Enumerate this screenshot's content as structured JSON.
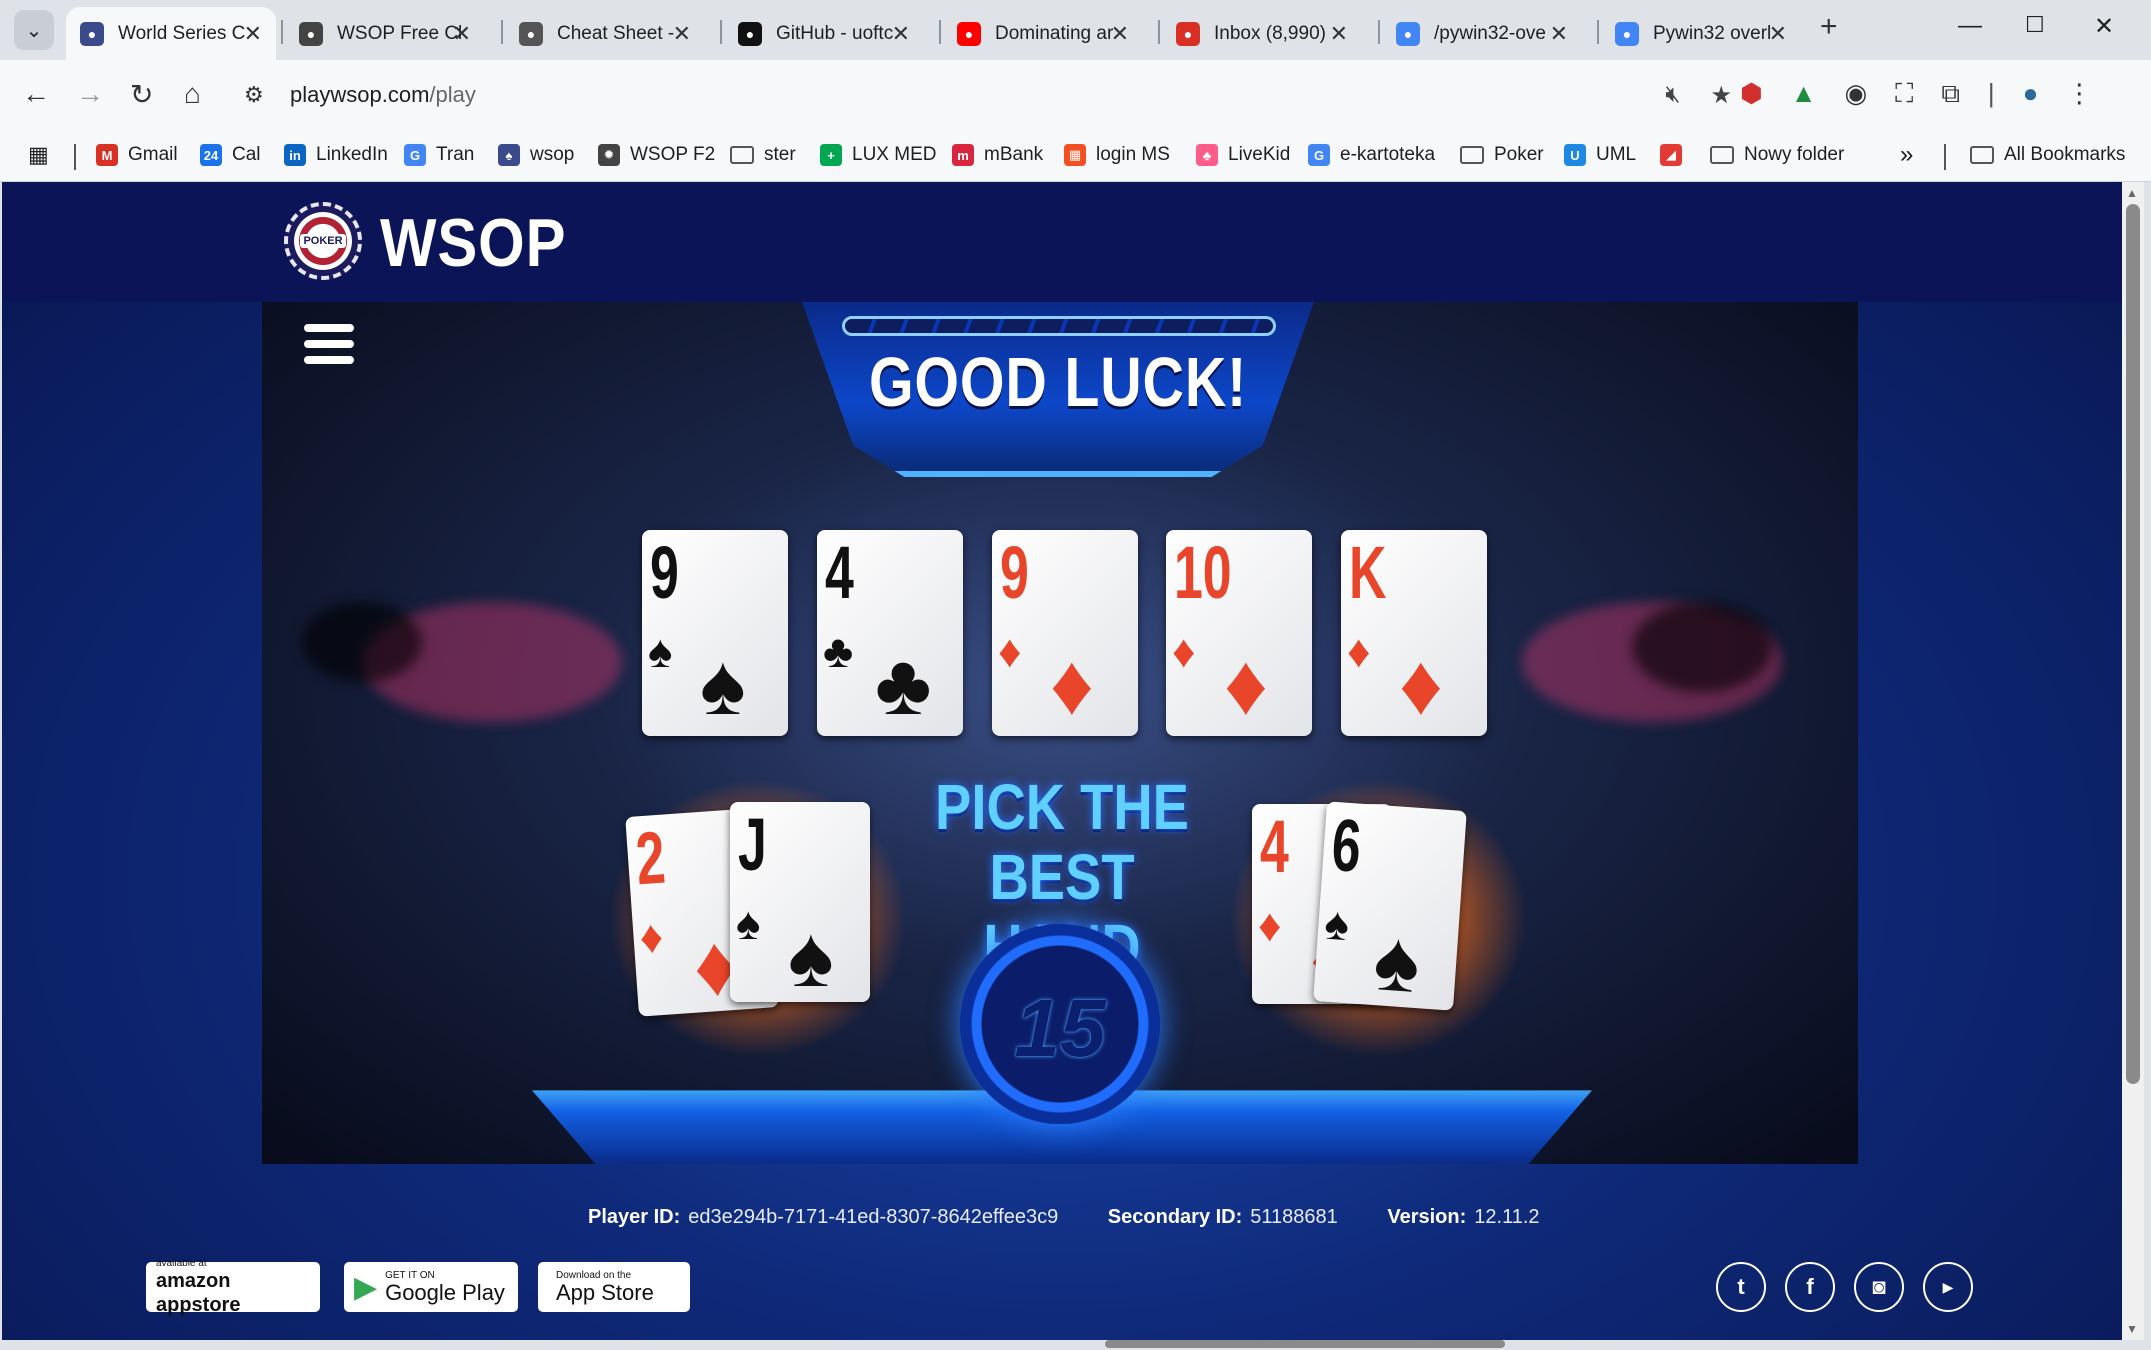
{
  "tabs": [
    {
      "title": "World Series C",
      "icon": "wsop-icon",
      "color": "#3b4a8a",
      "active": true
    },
    {
      "title": "WSOP Free Cl",
      "icon": "gear-icon",
      "color": "#444444"
    },
    {
      "title": "Cheat Sheet -",
      "icon": "sheet-icon",
      "color": "#555555"
    },
    {
      "title": "GitHub - uoftc",
      "icon": "github-icon",
      "color": "#111111"
    },
    {
      "title": "Dominating ar",
      "icon": "youtube-icon",
      "color": "#ff0000"
    },
    {
      "title": "Inbox (8,990)",
      "icon": "gmail-icon",
      "color": "#d93025"
    },
    {
      "title": "/pywin32-ove",
      "icon": "google-icon",
      "color": "#4285f4"
    },
    {
      "title": "Pywin32 overl",
      "icon": "google-icon",
      "color": "#4285f4"
    }
  ],
  "address": {
    "domain": "playwsop.com",
    "path": "/play"
  },
  "bookmarks": [
    {
      "label": "Gmail",
      "color": "#d93025",
      "glyph": "M"
    },
    {
      "label": "Cal",
      "color": "#1a73e8",
      "glyph": "24"
    },
    {
      "label": "LinkedIn",
      "color": "#0a66c2",
      "glyph": "in"
    },
    {
      "label": "Tran",
      "color": "#4285f4",
      "glyph": "G"
    },
    {
      "label": "wsop",
      "color": "#3b4a8a",
      "glyph": "♠"
    },
    {
      "label": "WSOP F2",
      "color": "#444444",
      "glyph": "✹"
    },
    {
      "label": "ster",
      "folder": true
    },
    {
      "label": "LUX MED",
      "color": "#00a651",
      "glyph": "+"
    },
    {
      "label": "mBank",
      "color": "#d7263d",
      "glyph": "m"
    },
    {
      "label": "login MS",
      "color": "#f25022",
      "glyph": "▦"
    },
    {
      "label": "LiveKid",
      "color": "#ff5c8a",
      "glyph": "♣"
    },
    {
      "label": "e-kartoteka",
      "color": "#4285f4",
      "glyph": "G"
    },
    {
      "label": "Poker",
      "folder": true
    },
    {
      "label": "UML",
      "color": "#1e88e5",
      "glyph": "U"
    },
    {
      "label": "",
      "color": "#e53935",
      "glyph": "◢"
    },
    {
      "label": "Nowy folder",
      "folder": true
    }
  ],
  "bookmarks_more": "»",
  "all_bookmarks": "All Bookmarks",
  "site": {
    "brand": "WSOP",
    "chip_label": "POKER"
  },
  "game": {
    "banner": "GOOD LUCK!",
    "prompt_line1": "PICK THE",
    "prompt_line2": "BEST HAND",
    "timer": "15",
    "community_cards": [
      {
        "rank": "9",
        "suit": "♠",
        "color": "black"
      },
      {
        "rank": "4",
        "suit": "♣",
        "color": "black"
      },
      {
        "rank": "9",
        "suit": "♦",
        "color": "red"
      },
      {
        "rank": "10",
        "suit": "♦",
        "color": "red"
      },
      {
        "rank": "K",
        "suit": "♦",
        "color": "red"
      }
    ],
    "left_hand": [
      {
        "rank": "2",
        "suit": "♦",
        "color": "red"
      },
      {
        "rank": "J",
        "suit": "♠",
        "color": "black"
      }
    ],
    "right_hand": [
      {
        "rank": "4",
        "suit": "♦",
        "color": "red"
      },
      {
        "rank": "6",
        "suit": "♠",
        "color": "black"
      }
    ]
  },
  "footer": {
    "player_id_label": "Player ID:",
    "player_id": "ed3e294b-7171-41ed-8307-8642effee3c9",
    "secondary_id_label": "Secondary ID:",
    "secondary_id": "51188681",
    "version_label": "Version:",
    "version": "12.11.2",
    "stores": [
      {
        "small": "available at",
        "big": "amazon appstore"
      },
      {
        "small": "GET IT ON",
        "big": "Google Play"
      },
      {
        "small": "Download on the",
        "big": "App Store"
      }
    ],
    "social": [
      "twitter-icon",
      "facebook-icon",
      "instagram-icon",
      "youtube-icon"
    ]
  }
}
